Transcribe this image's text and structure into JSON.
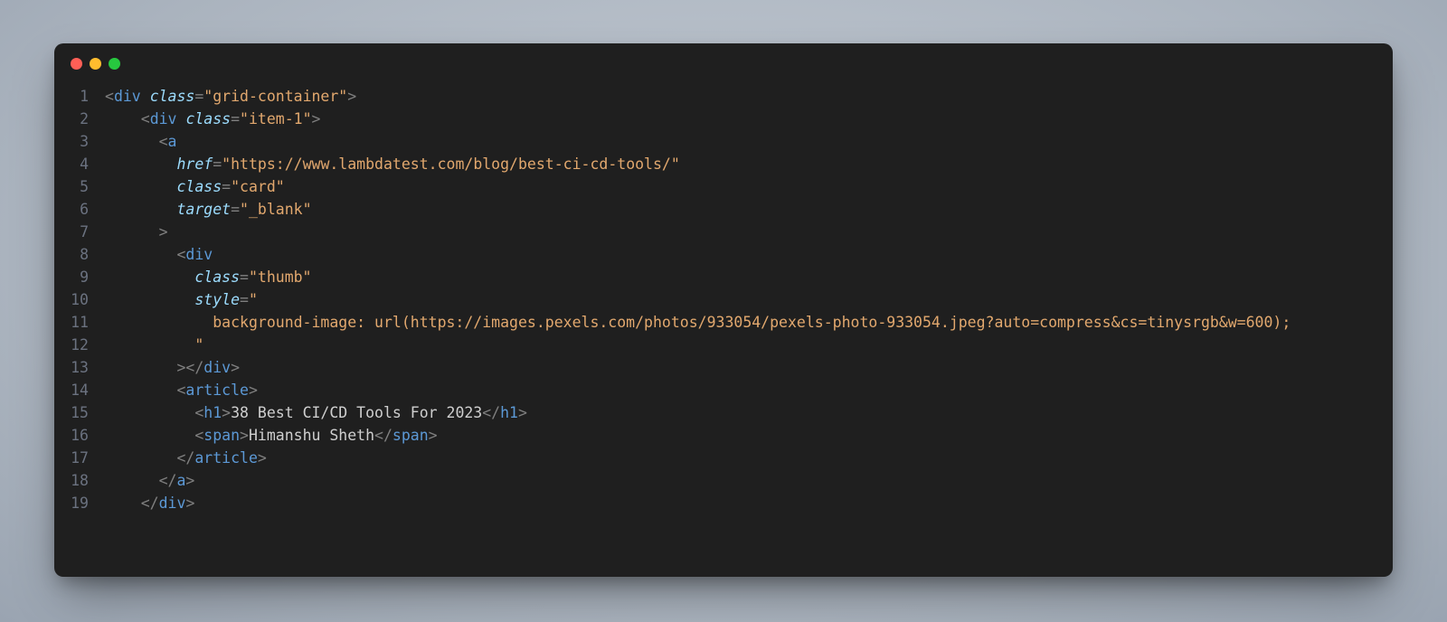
{
  "window": {
    "dots": [
      "red",
      "yellow",
      "green"
    ]
  },
  "code": {
    "line_numbers": [
      "1",
      "2",
      "3",
      "4",
      "5",
      "6",
      "7",
      "8",
      "9",
      "10",
      "11",
      "12",
      "13",
      "14",
      "15",
      "16",
      "17",
      "18",
      "19"
    ],
    "tokens": {
      "tag_div": "div",
      "tag_a": "a",
      "tag_article": "article",
      "tag_h1": "h1",
      "tag_span": "span",
      "attr_class": "class",
      "attr_href": "href",
      "attr_target": "target",
      "attr_style": "style",
      "val_grid_container": "\"grid-container\"",
      "val_item1": "\"item-1\"",
      "val_href": "\"https://www.lambdatest.com/blog/best-ci-cd-tools/\"",
      "val_card": "\"card\"",
      "val_blank": "\"_blank\"",
      "val_thumb": "\"thumb\"",
      "val_style_open": "\"",
      "style_body": "        background-image: url(https://images.pexels.com/photos/933054/pexels-photo-933054.jpeg?auto=compress&cs=tinysrgb&w=600);",
      "val_style_close": "      \"",
      "h1_text": "38 Best CI/CD Tools For 2023",
      "span_text": "Himanshu Sheth"
    }
  }
}
